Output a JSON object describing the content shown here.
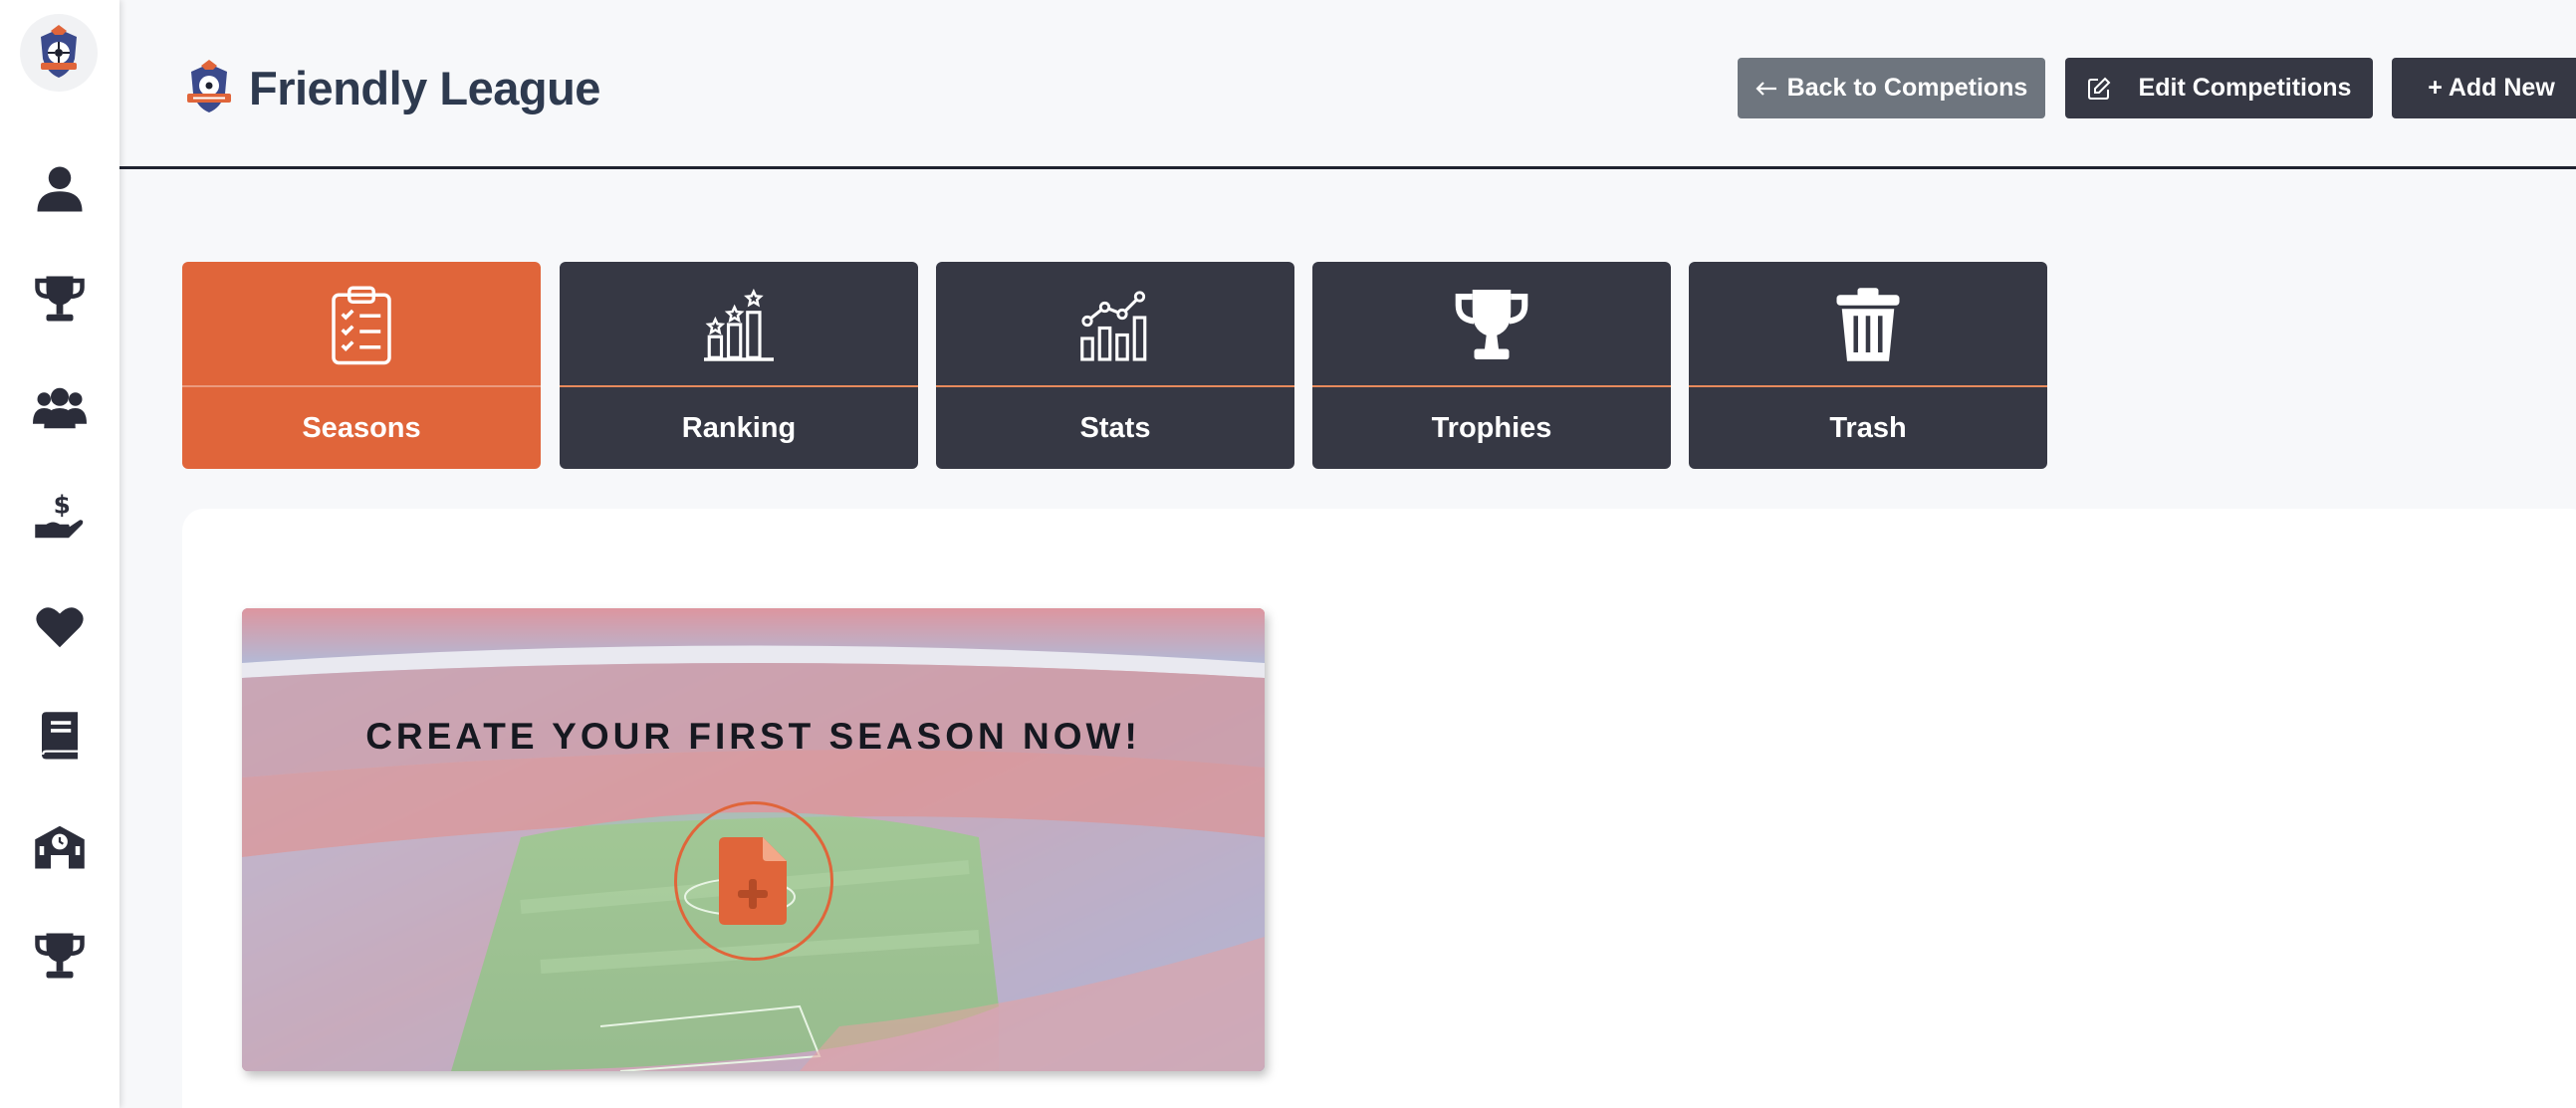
{
  "app": {
    "title": "Friendly League"
  },
  "sidebar": {
    "logo_icon": "league-badge-icon",
    "items": [
      {
        "name": "players",
        "icon": "user-icon"
      },
      {
        "name": "competitions",
        "icon": "trophy-icon"
      },
      {
        "name": "teams",
        "icon": "users-icon"
      },
      {
        "name": "finance",
        "icon": "hand-dollar-icon"
      },
      {
        "name": "favorites",
        "icon": "heart-icon"
      },
      {
        "name": "rules",
        "icon": "book-icon"
      },
      {
        "name": "clubs",
        "icon": "school-clock-icon"
      },
      {
        "name": "awards",
        "icon": "trophy-icon"
      }
    ]
  },
  "header": {
    "back_label": "Back to Competions",
    "edit_label": "Edit Competitions",
    "add_label": "+ Add New"
  },
  "tabs": [
    {
      "label": "Seasons",
      "icon": "clipboard-checklist-icon",
      "active": true
    },
    {
      "label": "Ranking",
      "icon": "ranking-podium-icon",
      "active": false
    },
    {
      "label": "Stats",
      "icon": "stats-chart-icon",
      "active": false
    },
    {
      "label": "Trophies",
      "icon": "trophy-icon",
      "active": false
    },
    {
      "label": "Trash",
      "icon": "trash-icon",
      "active": false
    }
  ],
  "empty_state": {
    "title": "CREATE YOUR FIRST SEASON NOW!",
    "button_icon": "file-plus-icon"
  },
  "colors": {
    "accent": "#e0653a",
    "dark": "#363844",
    "gray_button": "#6e757e",
    "title": "#2e3a4f",
    "background": "#f7f8fa"
  }
}
